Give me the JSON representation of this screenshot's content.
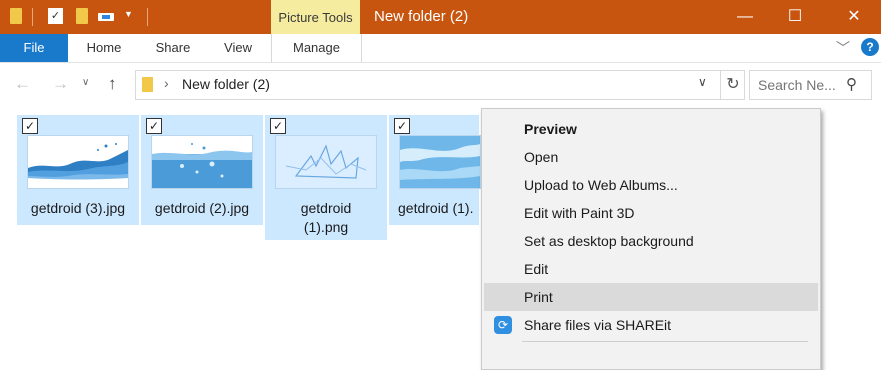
{
  "window": {
    "title": "New folder (2)",
    "contextual_tab": "Picture Tools",
    "controls": {
      "minimize": "—",
      "maximize": "☐",
      "close": "✕"
    }
  },
  "ribbon": {
    "file": "File",
    "tabs": [
      "Home",
      "Share",
      "View",
      "Manage"
    ]
  },
  "address": {
    "path": "New folder (2)",
    "search_placeholder": "Search Ne..."
  },
  "files": [
    {
      "name": "getdroid (3).jpg",
      "checked": true
    },
    {
      "name": "getdroid (2).jpg",
      "checked": true
    },
    {
      "name": "getdroid (1).png",
      "checked": true
    },
    {
      "name": "getdroid (1).",
      "checked": true
    }
  ],
  "context_menu": {
    "items": [
      {
        "label": "Preview",
        "bold": true
      },
      {
        "label": "Open"
      },
      {
        "label": "Upload to Web Albums..."
      },
      {
        "label": "Edit with Paint 3D"
      },
      {
        "label": "Set as desktop background"
      },
      {
        "label": "Edit"
      },
      {
        "label": "Print",
        "highlighted": true
      },
      {
        "label": "Share files via SHAREit",
        "icon": "shareit-icon"
      }
    ]
  },
  "colors": {
    "titlebar": "#c8550f",
    "contextual_tab": "#f6eca0",
    "file_tab": "#1979ca",
    "selection": "#cce8ff"
  }
}
